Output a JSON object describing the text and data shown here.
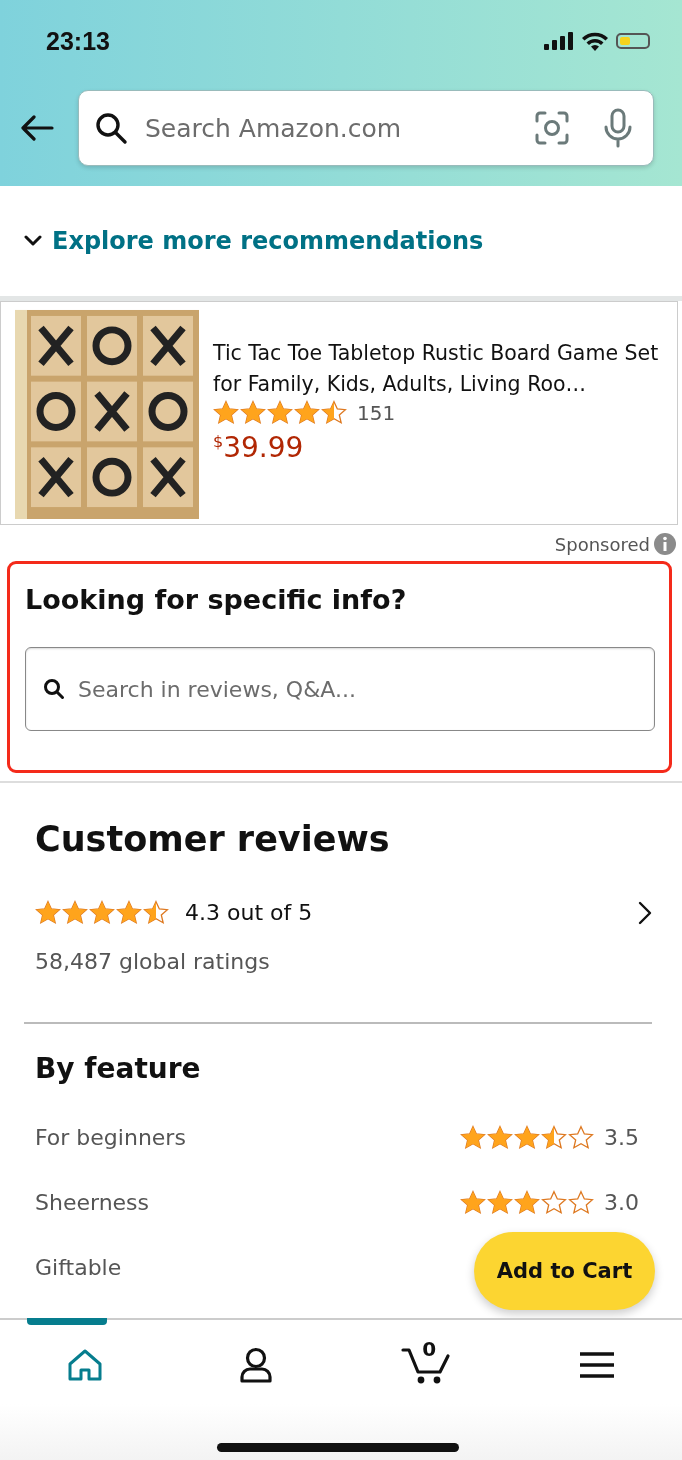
{
  "status_bar": {
    "time": "23:13"
  },
  "search": {
    "placeholder": "Search Amazon.com"
  },
  "explore_link": "Explore more recommendations",
  "product": {
    "title": "Tic Tac Toe Tabletop Rustic Board Game Set for Family, Kids, Adults, Living Roo…",
    "stars": 4.5,
    "rating_count": "151",
    "currency": "$",
    "price": "39.99",
    "sponsored": "Sponsored"
  },
  "info_search": {
    "heading": "Looking for specific info?",
    "placeholder": "Search in reviews, Q&A..."
  },
  "reviews": {
    "heading": "Customer reviews",
    "stars": 4.5,
    "rating": "4.3 out of 5",
    "global_ratings": "58,487 global ratings"
  },
  "by_feature": {
    "heading": "By feature",
    "features": [
      {
        "name": "For beginners",
        "stars": 3.5,
        "reading": "3.5"
      },
      {
        "name": "Sheerness",
        "stars": 3,
        "reading": "3.0"
      },
      {
        "name": "Giftable"
      }
    ]
  },
  "add_to_cart": "Add to Cart",
  "tab_bar": {
    "tabs": [
      {
        "kind": "home",
        "selected": true
      },
      {
        "kind": "account",
        "selected": false
      },
      {
        "kind": "cart",
        "selected": false,
        "count": "0"
      },
      {
        "kind": "menu",
        "selected": false
      }
    ]
  }
}
